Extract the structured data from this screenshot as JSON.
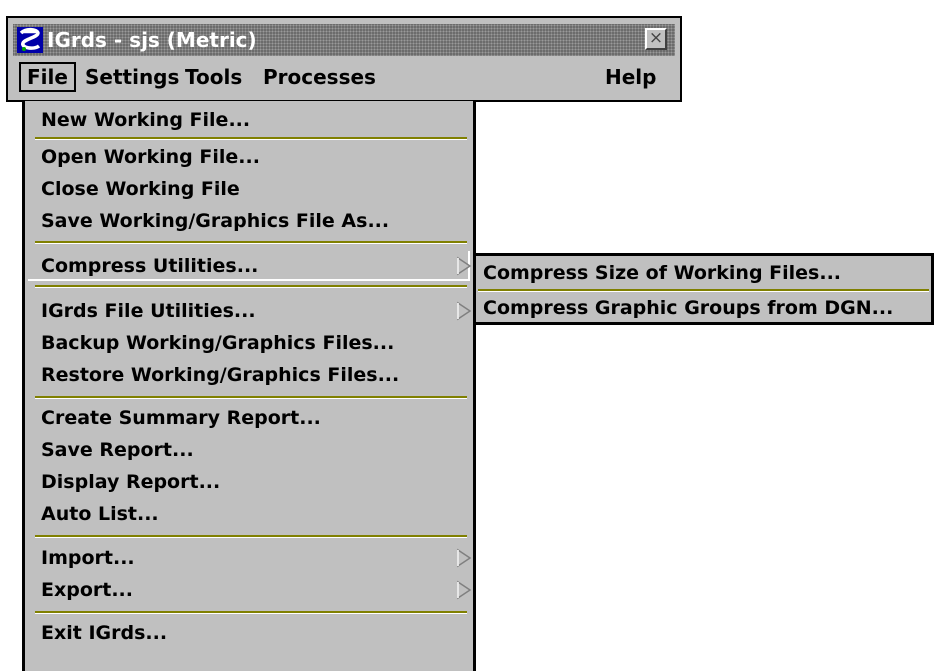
{
  "window": {
    "title": "IGrds - sjs (Metric)",
    "app_icon": "igrds-app-icon",
    "close_icon": "close-x-icon"
  },
  "menubar": {
    "file": "File",
    "settings": "Settings",
    "tools": "Tools",
    "processes": "Processes",
    "help": "Help"
  },
  "file_menu": {
    "items": [
      "New Working File...",
      "Open Working File...",
      "Close Working File",
      "Save Working/Graphics File As...",
      "Compress Utilities...",
      "IGrds File Utilities...",
      "Backup Working/Graphics Files...",
      "Restore Working/Graphics Files...",
      "Create Summary Report...",
      "Save Report...",
      "Display Report...",
      "Auto List...",
      "Import...",
      "Export...",
      "Exit IGrds..."
    ],
    "submenu_arrow_icon": "submenu-triangle-icon"
  },
  "compress_submenu": {
    "items": [
      "Compress Size of Working Files...",
      "Compress Graphic Groups from DGN..."
    ]
  },
  "colors": {
    "menu_face": "#c0c0c0",
    "separator": "#808000",
    "titlebar": "#6a6a6a"
  }
}
